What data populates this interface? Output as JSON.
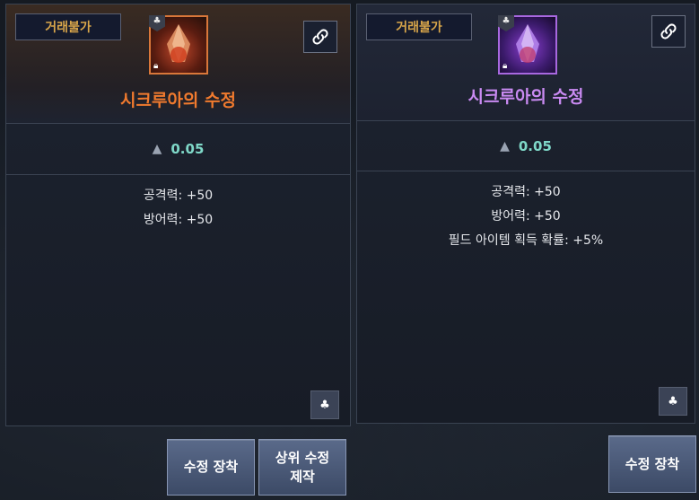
{
  "left_card": {
    "badge": "거래불가",
    "item_name": "시크루아의 수정",
    "weight": "0.05",
    "stats": [
      "공격력: +50",
      "방어력: +50"
    ]
  },
  "right_card": {
    "badge": "거래불가",
    "item_name": "시크루아의 수정",
    "weight": "0.05",
    "stats": [
      "공격력: +50",
      "방어력: +50",
      "필드 아이템 획득 확률: +5%"
    ]
  },
  "buttons": {
    "equip_left": "수정 장착",
    "craft_upper": "상위 수정 제작",
    "equip_right": "수정 장착"
  },
  "colors": {
    "left_name": "#f07a2e",
    "right_name": "#c98af2",
    "badge_text": "#d9a64a",
    "weight_text": "#7fd8c8"
  }
}
